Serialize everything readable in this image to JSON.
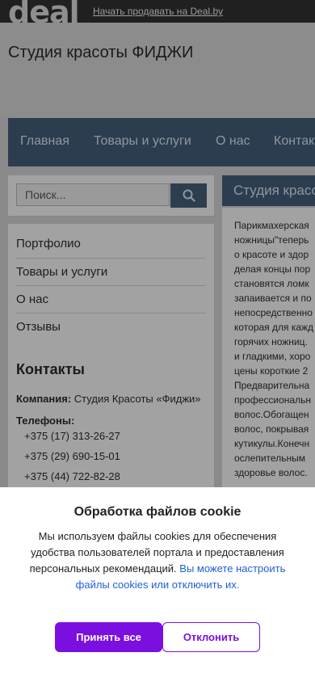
{
  "topbar": {
    "logo": "deal",
    "sell_link": "Начать продавать на Deal.by"
  },
  "header": {
    "store_name": "Студия красоты ФИДЖИ"
  },
  "nav": {
    "items": [
      "Главная",
      "Товары и услуги",
      "О нас",
      "Контакты"
    ]
  },
  "search": {
    "placeholder": "Поиск..."
  },
  "sidebar": {
    "items": [
      {
        "label": "Портфолио"
      },
      {
        "label": "Товары и услуги"
      },
      {
        "label": "О нас"
      },
      {
        "label": "Отзывы"
      }
    ],
    "contacts_title": "Контакты",
    "company_label": "Компания:",
    "company_value": "Студия Красоты «Фиджи»",
    "phones_label": "Телефоны:",
    "phones": [
      "+375 (17) 313-26-27",
      "+375 (29) 690-15-01",
      "+375 (44) 722-82-28"
    ]
  },
  "content": {
    "title": "Студия красоты ФИДЖИ",
    "lines": [
      "Парикмахерская",
      "ножницы\"теперь",
      "о красоте и здор",
      "делая концы пор",
      "становятся ломк",
      "запаивается и по",
      "непосредственно",
      "которая для кажд",
      "горячих ножниц.",
      "и гладкими, хоро",
      "цены короткие 2",
      "Предварительна",
      "профессиональн",
      "волос.Обогащен",
      "волос, покрывая",
      "кутикулы.Конечн",
      "ослепительным",
      "здоровье волос."
    ]
  },
  "cookie": {
    "title": "Обработка файлов cookie",
    "text": "Мы используем файлы cookies для обеспечения удобства пользователей портала и предоставления персональных рекомендаций.",
    "link": "Вы можете настроить файлы cookies или отключить их.",
    "accept": "Принять все",
    "decline": "Отклонить"
  },
  "colors": {
    "nav_bg": "#2c3d50",
    "accent": "#7a0fe0",
    "link": "#1f5fd6"
  }
}
